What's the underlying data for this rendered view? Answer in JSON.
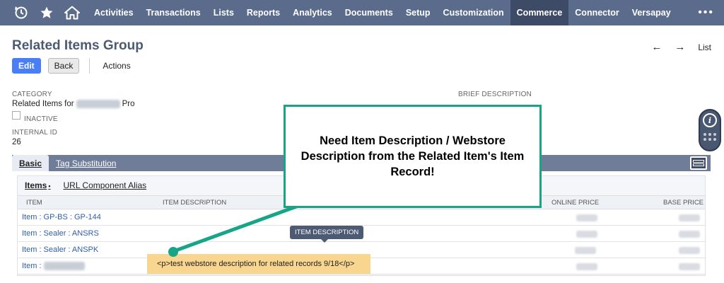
{
  "nav": {
    "items": [
      "Activities",
      "Transactions",
      "Lists",
      "Reports",
      "Analytics",
      "Documents",
      "Setup",
      "Customization",
      "Commerce",
      "Connector",
      "Versapay"
    ],
    "active": "Commerce",
    "more": "•••"
  },
  "page": {
    "title": "Related Items Group",
    "pager_prev": "←",
    "pager_next": "→",
    "pager_list": "List"
  },
  "buttons": {
    "edit": "Edit",
    "back": "Back",
    "actions": "Actions"
  },
  "fields": {
    "category_label": "CATEGORY",
    "category_prefix": "Related Items for",
    "category_suffix": "Pro",
    "inactive_label": "INACTIVE",
    "internal_id_label": "INTERNAL ID",
    "internal_id_value": "26",
    "brief_description_label": "BRIEF DESCRIPTION"
  },
  "subtabs": [
    "Basic",
    "Tag Substitution"
  ],
  "inner_tabs": {
    "items": "Items",
    "items_marker": "•",
    "url_alias": "URL Component Alias"
  },
  "grid": {
    "headers": {
      "item": "ITEM",
      "item_description": "ITEM DESCRIPTION",
      "online_price": "ONLINE PRICE",
      "base_price": "BASE PRICE"
    },
    "rows": [
      {
        "item": "Item : GP-BS : GP-144"
      },
      {
        "item": "Item : Sealer : ANSRS"
      },
      {
        "item": "Item : Sealer : ANSPK"
      },
      {
        "item": "Item :"
      }
    ]
  },
  "tooltip": "ITEM DESCRIPTION",
  "highlight_text": "<p>test webstore description for related records 9/18</p>",
  "callout": {
    "text": "Need Item Description / Webstore Description from the Related Item's Item Record!",
    "border_color": "#17a589"
  },
  "colors": {
    "nav_bg": "#5b6b8c",
    "nav_active": "#3e4b66",
    "primary_button": "#4a7ef5",
    "link": "#2e5fa8",
    "highlight": "#f8d690"
  }
}
